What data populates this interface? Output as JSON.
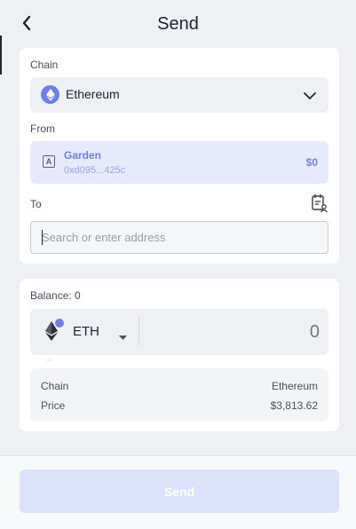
{
  "header": {
    "title": "Send"
  },
  "chain": {
    "label": "Chain",
    "selected": "Ethereum",
    "icon": "ethereum-icon",
    "accent": "#6f7fe8"
  },
  "from": {
    "label": "From",
    "wallet_name": "Garden",
    "wallet_address": "0xd095...425c",
    "balance": "$0",
    "icon": "wallet-icon"
  },
  "to": {
    "label": "To",
    "placeholder": "Search or enter address",
    "value": "",
    "addressbook_icon": "address-book-icon"
  },
  "amount": {
    "balance_label": "Balance: 0",
    "token": "ETH",
    "value": "0"
  },
  "details": {
    "rows": [
      {
        "key": "Chain",
        "value": "Ethereum"
      },
      {
        "key": "Price",
        "value": "$3,813.62"
      }
    ]
  },
  "footer": {
    "send_label": "Send",
    "button_color": "#dde2fb"
  }
}
